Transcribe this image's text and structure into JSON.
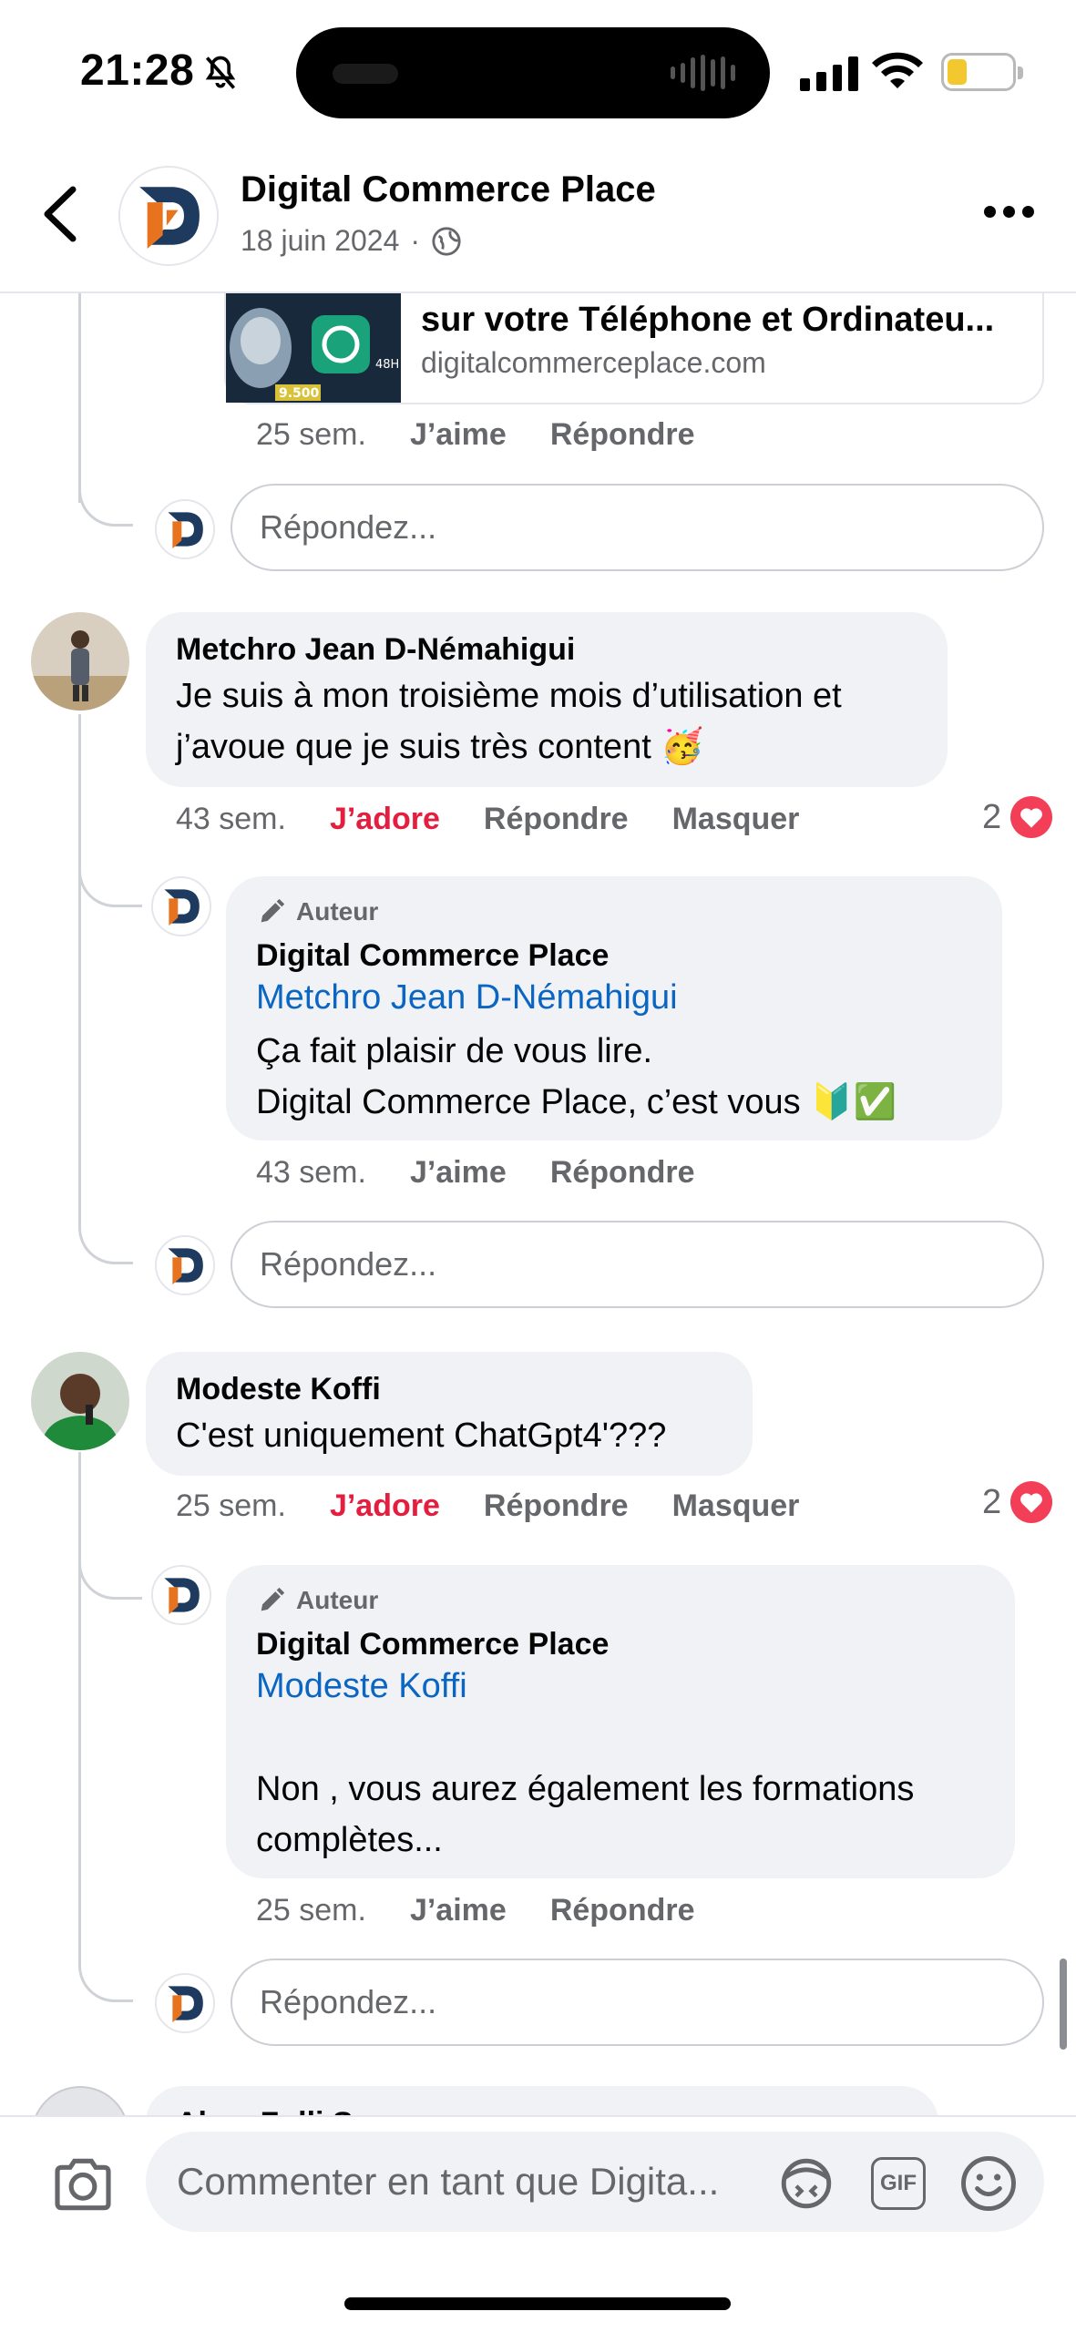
{
  "status_bar": {
    "time": "21:28"
  },
  "header": {
    "page_name": "Digital Commerce Place",
    "date": "18 juin 2024",
    "separator": "·"
  },
  "link_preview": {
    "title": "sur votre Téléphone et Ordinateu...",
    "domain": "digitalcommerceplace.com",
    "thumb_price": "9.500",
    "thumb_badge": "48H"
  },
  "reply_block_0": {
    "time": "25 sem.",
    "like": "J’aime",
    "reply": "Répondre"
  },
  "reply_placeholder": "Répondez...",
  "comment_1": {
    "author": "Metchro Jean D-Némahigui",
    "text_line1": "Je suis à mon troisième mois d’utilisation et",
    "text_line2": "j’avoue que je suis très content 🥳",
    "time": "43 sem.",
    "reaction": "J’adore",
    "reply": "Répondre",
    "hide": "Masquer",
    "reaction_count": "2"
  },
  "reply_1": {
    "badge": "Auteur",
    "author": "Digital Commerce Place",
    "mention": "Metchro Jean D-Némahigui",
    "line1": "Ça fait plaisir de vous lire.",
    "line2": "Digital Commerce Place, c’est vous 🔰✅",
    "time": "43 sem.",
    "like": "J’aime",
    "reply": "Répondre"
  },
  "comment_2": {
    "author": "Modeste Koffi",
    "text": "C'est uniquement ChatGpt4'???",
    "time": "25 sem.",
    "reaction": "J’adore",
    "reply": "Répondre",
    "hide": "Masquer",
    "reaction_count": "2"
  },
  "reply_2": {
    "badge": "Auteur",
    "author": "Digital Commerce Place",
    "mention": "Modeste Koffi",
    "line1": "Non , vous aurez également les formations",
    "line2": "complètes...",
    "time": "25 sem.",
    "like": "J’aime",
    "reply": "Répondre"
  },
  "comment_3_partial": {
    "author": "Alma Zolli S..."
  },
  "composer": {
    "placeholder": "Commenter en tant que Digita...",
    "gif": "GIF"
  },
  "colors": {
    "love_red": "#e41e3f",
    "mention_blue": "#0a66c2",
    "logo_orange": "#e8731f",
    "logo_navy": "#1f3a5f"
  },
  "icons": [
    "back-icon",
    "globe-icon",
    "more-icon",
    "camera-icon",
    "avatar-sticker-icon",
    "gif-icon",
    "emoji-icon",
    "pencil-icon",
    "heart-icon"
  ]
}
